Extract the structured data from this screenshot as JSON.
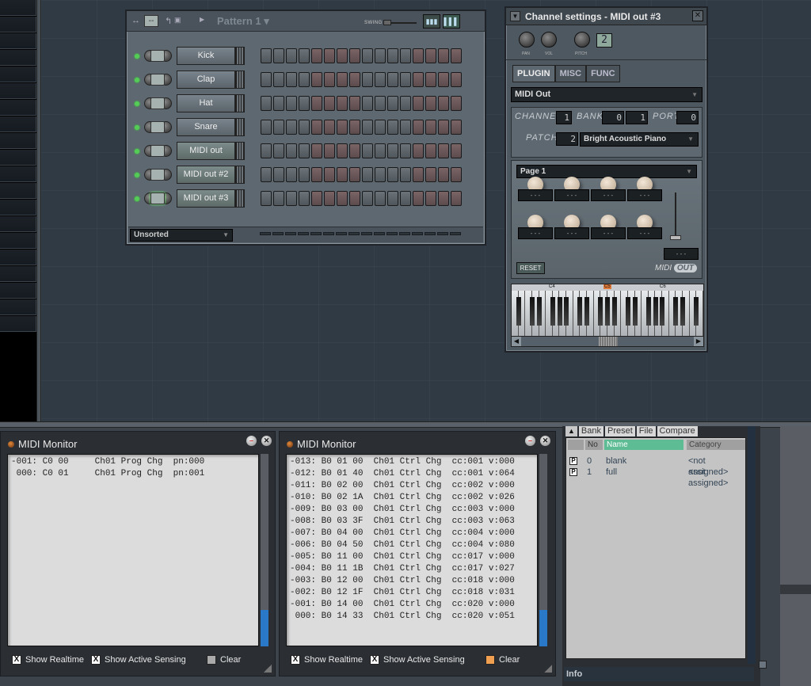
{
  "sequencer": {
    "pattern_title": "Pattern 1",
    "swing_label": "SWING",
    "selector_label": "--",
    "view_buttons": [
      "graph-view",
      "keyboard-view"
    ],
    "channels": [
      {
        "name": "Kick",
        "selected": false
      },
      {
        "name": "Clap",
        "selected": false
      },
      {
        "name": "Hat",
        "selected": false
      },
      {
        "name": "Snare",
        "selected": false
      },
      {
        "name": "MIDI out",
        "selected": false
      },
      {
        "name": "MIDI out #2",
        "selected": false
      },
      {
        "name": "MIDI out #3",
        "selected": true
      }
    ],
    "step_count": 16,
    "filter": "Unsorted"
  },
  "channel_settings": {
    "title": "Channel settings - MIDI out #3",
    "knob_labels": {
      "pan": "PAN",
      "vol": "VOL",
      "pitch": "PITCH"
    },
    "pitch_range": "2",
    "tabs": [
      {
        "label": "PLUGIN",
        "active": true
      },
      {
        "label": "MISC",
        "active": false
      },
      {
        "label": "FUNC",
        "active": false
      }
    ],
    "plugin": "MIDI Out",
    "labels": {
      "channel": "CHANNEL",
      "bank": "BANK",
      "port": "PORT",
      "patch": "PATCH"
    },
    "channel": "1",
    "bank_lsb": "0",
    "bank_msb": "1",
    "port": "0",
    "patch": "2",
    "patch_name": "Bright Acoustic Piano",
    "page": "Page 1",
    "knob_value_placeholder": "- - -",
    "reset_label": "RESET",
    "logo_text": "MIDI",
    "logo_badge": "OUT",
    "octave_labels": [
      "C4",
      "C5",
      "C6"
    ],
    "highlight_octave": "C5"
  },
  "monitor1": {
    "title": "MIDI Monitor",
    "lines": [
      "-001: C0 00     Ch01 Prog Chg  pn:000",
      " 000: C0 01     Ch01 Prog Chg  pn:001"
    ],
    "options": {
      "show_realtime": "Show Realtime",
      "show_active_sensing": "Show Active Sensing",
      "clear": "Clear"
    },
    "checks": {
      "show_realtime": true,
      "show_active_sensing": true,
      "clear": false
    }
  },
  "monitor2": {
    "title": "MIDI Monitor",
    "lines": [
      "-013: B0 01 00  Ch01 Ctrl Chg  cc:001 v:000",
      "-012: B0 01 40  Ch01 Ctrl Chg  cc:001 v:064",
      "-011: B0 02 00  Ch01 Ctrl Chg  cc:002 v:000",
      "-010: B0 02 1A  Ch01 Ctrl Chg  cc:002 v:026",
      "-009: B0 03 00  Ch01 Ctrl Chg  cc:003 v:000",
      "-008: B0 03 3F  Ch01 Ctrl Chg  cc:003 v:063",
      "-007: B0 04 00  Ch01 Ctrl Chg  cc:004 v:000",
      "-006: B0 04 50  Ch01 Ctrl Chg  cc:004 v:080",
      "-005: B0 11 00  Ch01 Ctrl Chg  cc:017 v:000",
      "-004: B0 11 1B  Ch01 Ctrl Chg  cc:017 v:027",
      "-003: B0 12 00  Ch01 Ctrl Chg  cc:018 v:000",
      "-002: B0 12 1F  Ch01 Ctrl Chg  cc:018 v:031",
      "-001: B0 14 00  Ch01 Ctrl Chg  cc:020 v:000",
      " 000: B0 14 33  Ch01 Ctrl Chg  cc:020 v:051"
    ],
    "options": {
      "show_realtime": "Show Realtime",
      "show_active_sensing": "Show Active Sensing",
      "clear": "Clear"
    },
    "checks": {
      "show_realtime": true,
      "show_active_sensing": true,
      "clear": false
    }
  },
  "preset_browser": {
    "tabs": [
      "Bank",
      "Preset",
      "File",
      "Compare"
    ],
    "columns": {
      "no": "No",
      "name": "Name",
      "category": "Category"
    },
    "rows": [
      {
        "no": "0",
        "name": "blank",
        "category": "<not assigned>"
      },
      {
        "no": "1",
        "name": "full",
        "category": "<not assigned>"
      }
    ],
    "info_label": "Info"
  },
  "colors": {
    "accent_green": "#5ebc94",
    "scroll_blue": "#2a78c8",
    "octave_highlight": "#e07a3a"
  }
}
